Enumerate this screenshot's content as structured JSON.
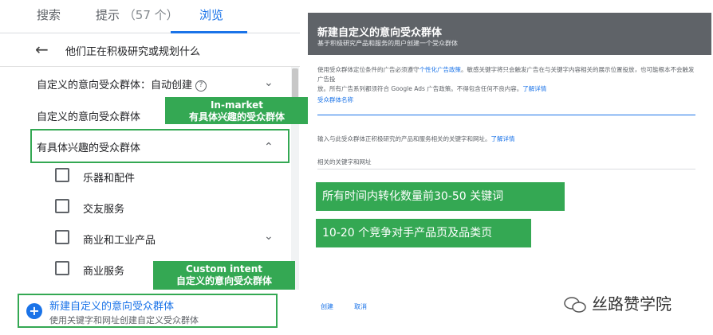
{
  "tabs": {
    "search": "搜索",
    "suggest": "提示",
    "suggest_count": "（57 个）",
    "browse": "浏览"
  },
  "back_row": {
    "label": "他们正在积极研究或规划什么"
  },
  "rows": {
    "custom_auto": "自定义的意向受众群体：自动创建",
    "custom": "自定义的意向受众群体",
    "in_market": "有具体兴趣的受众群体"
  },
  "checkbox_items": [
    {
      "label": "乐器和配件"
    },
    {
      "label": "交友服务"
    },
    {
      "label": "商业和工业产品"
    },
    {
      "label": "商业服务"
    }
  ],
  "create_new": {
    "title": "新建自定义的意向受众群体",
    "subtitle": "使用关键字和网址创建自定义受众群体"
  },
  "callouts": {
    "in_market_en": "In-market",
    "in_market_cn": "有具体兴趣的受众群体",
    "custom_intent_en": "Custom intent",
    "custom_intent_cn": "自定义的意向受众群体"
  },
  "dialog": {
    "title": "新建自定义的意向受众群体",
    "subtitle": "基于积极研究产品和服务的用户创建一个受众群体",
    "desc_line1": "使用受众群体定位条件的广告必须遵守",
    "desc_link1": "个性化广告政策",
    "desc_line1b": "。敏感关键字将只会触发广告在与关键字内容相关的展示位置投放，也可能根本不会触发广告投",
    "desc_line2": "放。所有广告系列都须符合 Google Ads 广告政策。不得包含任何不良内容。",
    "desc_link2": "了解详情",
    "name_label": "受众群体名称",
    "kw_desc": "输入与此受众群体正积极研究的产品和服务相关的关键字和网址。",
    "kw_desc_link": "了解详情",
    "kw_label": "相关的关键字和网址",
    "create_btn": "创建",
    "cancel_btn": "取消"
  },
  "notes": {
    "bar1": "所有时间内转化数量前30-50 关键词",
    "bar2": "10-20 个竞争对手产品页及品类页"
  },
  "watermark": "丝路赞学院",
  "colors": {
    "accent": "#1a73e8",
    "highlight": "#34a853",
    "dialog_header": "#5f6368"
  }
}
